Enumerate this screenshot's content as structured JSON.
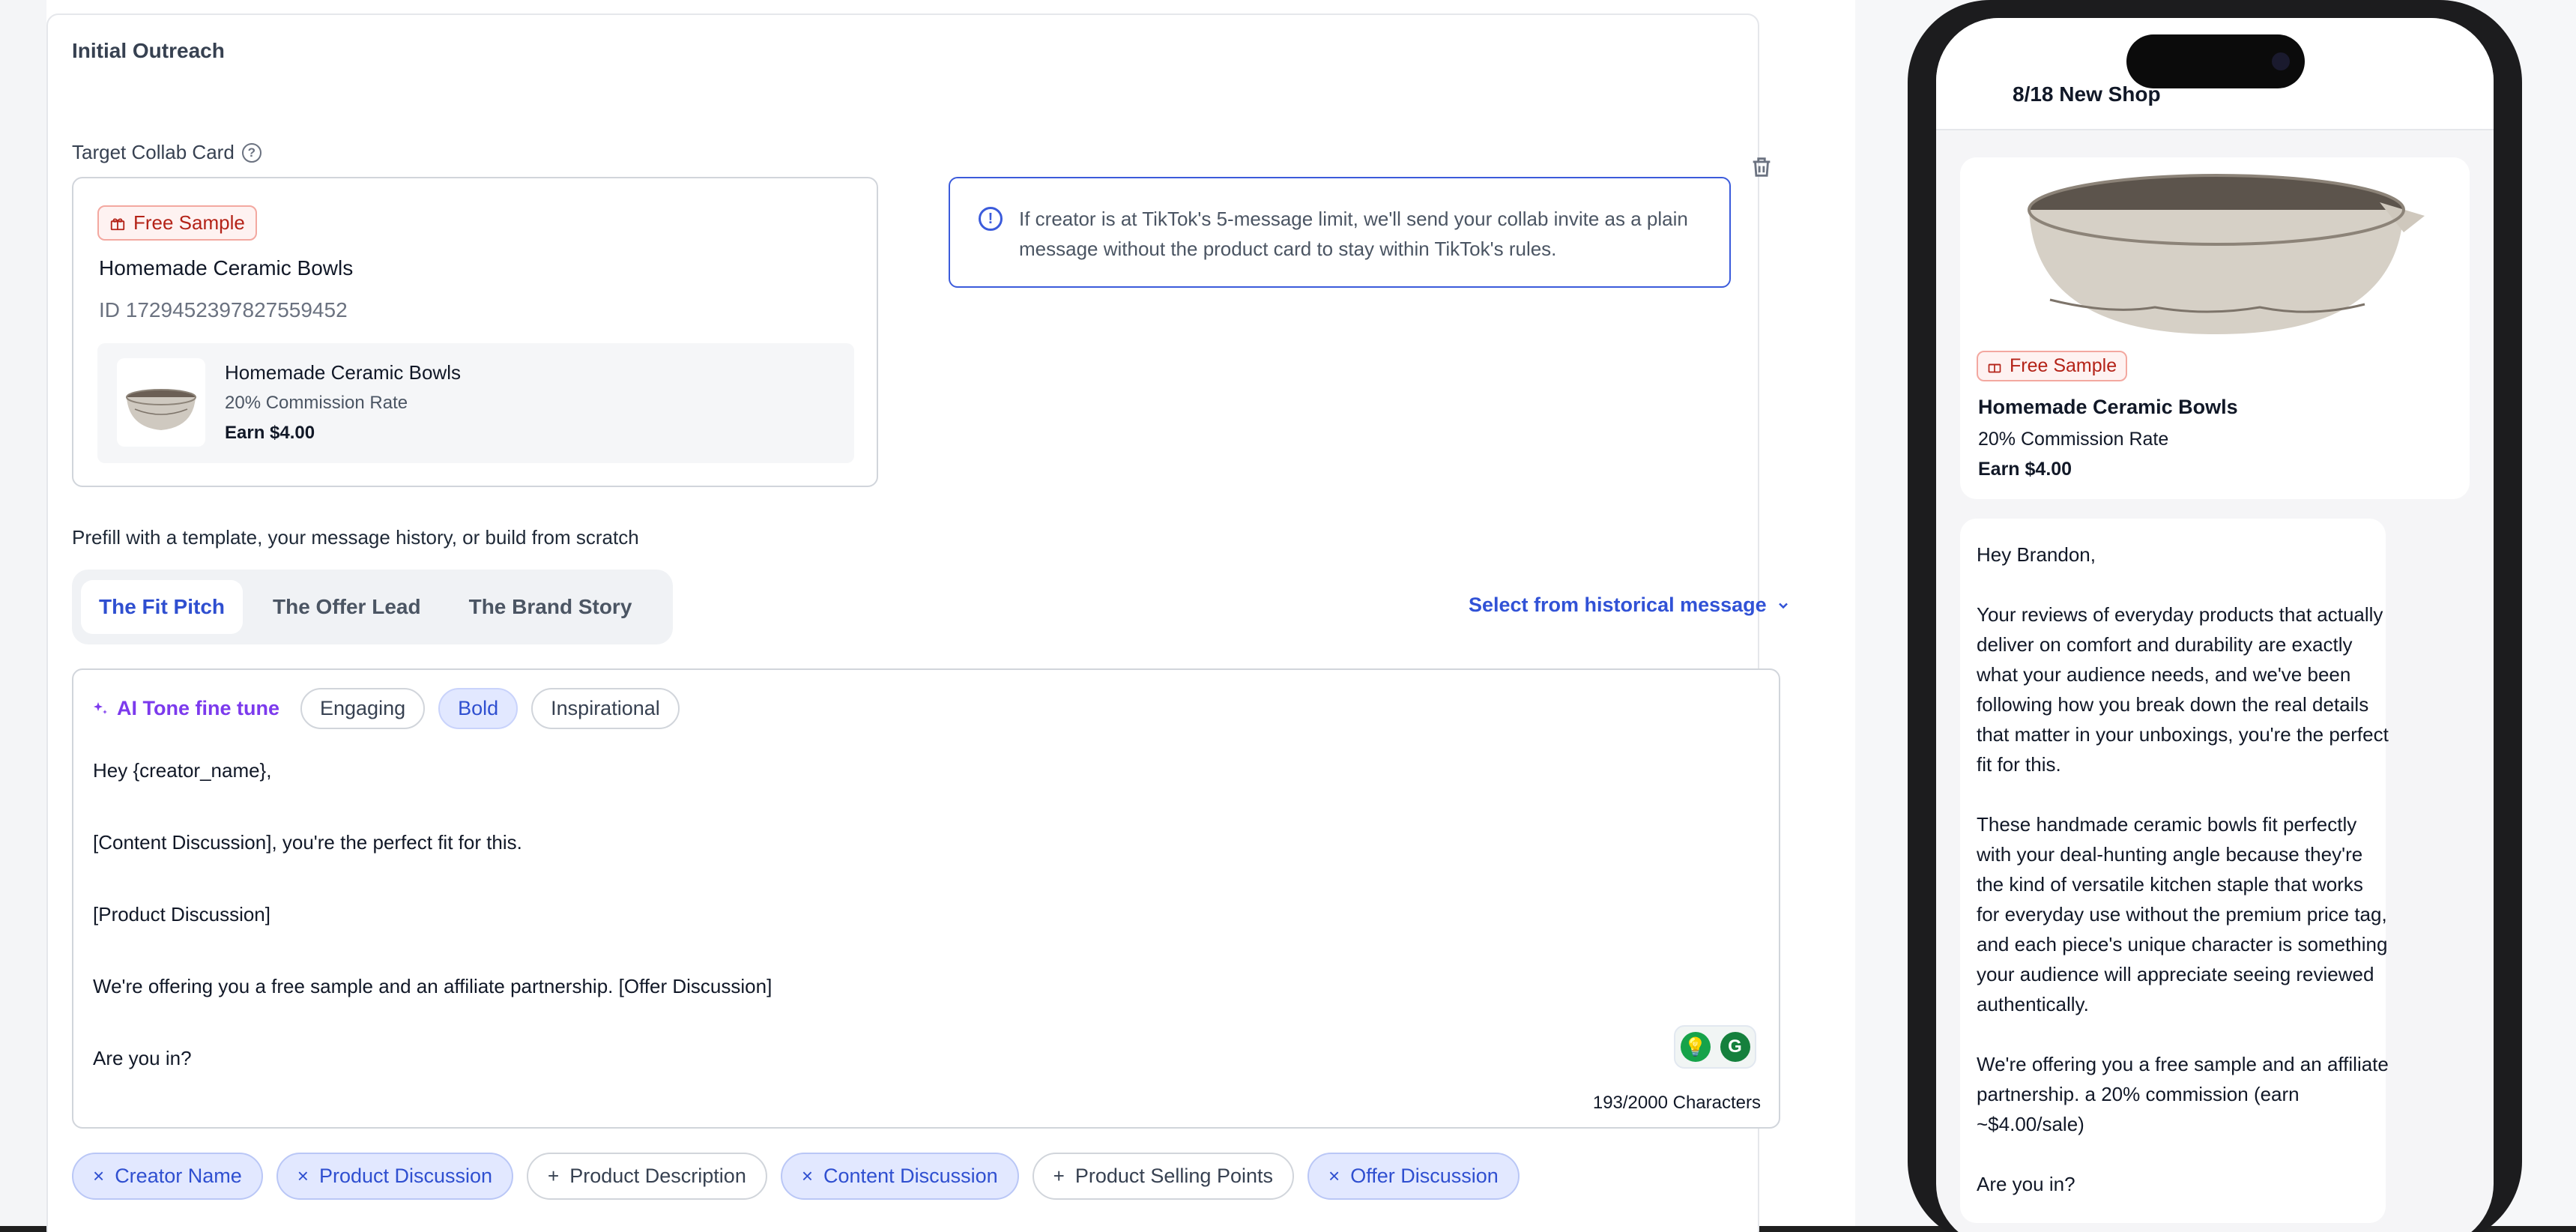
{
  "outreach": {
    "section_title": "Initial Outreach",
    "collab_label": "Target Collab Card",
    "collab_card": {
      "badge": "Free Sample",
      "product_name": "Homemade Ceramic Bowls",
      "product_id": "ID 1729452397827559452",
      "row": {
        "name": "Homemade Ceramic Bowls",
        "commission": "20% Commission Rate",
        "earn": "Earn $4.00"
      }
    },
    "info_text": "If creator is at TikTok's 5-message limit, we'll send your collab invite as a plain message without the product card to stay within TikTok's rules.",
    "prefill_label": "Prefill with a template, your message history, or build from scratch",
    "tabs": [
      {
        "label": "The Fit Pitch",
        "active": true
      },
      {
        "label": "The Offer Lead",
        "active": false
      },
      {
        "label": "The Brand Story",
        "active": false
      }
    ],
    "history_select": "Select from historical message",
    "tone": {
      "label": "AI Tone fine tune",
      "options": [
        {
          "label": "Engaging",
          "active": false
        },
        {
          "label": "Bold",
          "active": true
        },
        {
          "label": "Inspirational",
          "active": false
        }
      ]
    },
    "message": "Hey {creator_name},\n\n[Content Discussion], you're the perfect fit for this.\n\n[Product Discussion]\n\nWe're offering you a free sample and an affiliate partnership. [Offer Discussion]\n\nAre you in?",
    "char_count": "193/2000 Characters",
    "variables": [
      {
        "label": "Creator Name",
        "selected": true
      },
      {
        "label": "Product Discussion",
        "selected": true
      },
      {
        "label": "Product Description",
        "selected": false
      },
      {
        "label": "Content Discussion",
        "selected": true
      },
      {
        "label": "Product Selling Points",
        "selected": false
      },
      {
        "label": "Offer Discussion",
        "selected": true
      }
    ]
  },
  "phone": {
    "title": "8/18 New Shop",
    "card": {
      "badge": "Free Sample",
      "name": "Homemade Ceramic Bowls",
      "commission": "20% Commission Rate",
      "earn": "Earn $4.00"
    },
    "message": "Hey Brandon,\n\nYour reviews of everyday products that actually deliver on comfort and durability are exactly what your audience needs, and we've been following how you break down the real details that matter in your unboxings, you're the perfect fit for this.\n\nThese handmade ceramic bowls fit perfectly with your deal-hunting angle because they're the kind of versatile kitchen staple that works for everyday use without the premium price tag, and each piece's unique character is something your audience will appreciate seeing reviewed authentically.\n\nWe're offering you a free sample and an affiliate partnership. a 20% commission (earn ~$4.00/sale)\n\nAre you in?"
  },
  "colors": {
    "accent": "#2f4fd0",
    "tone_accent": "#7c3aed",
    "badge_red": "#b42318",
    "info_border": "#3b5bdb"
  }
}
